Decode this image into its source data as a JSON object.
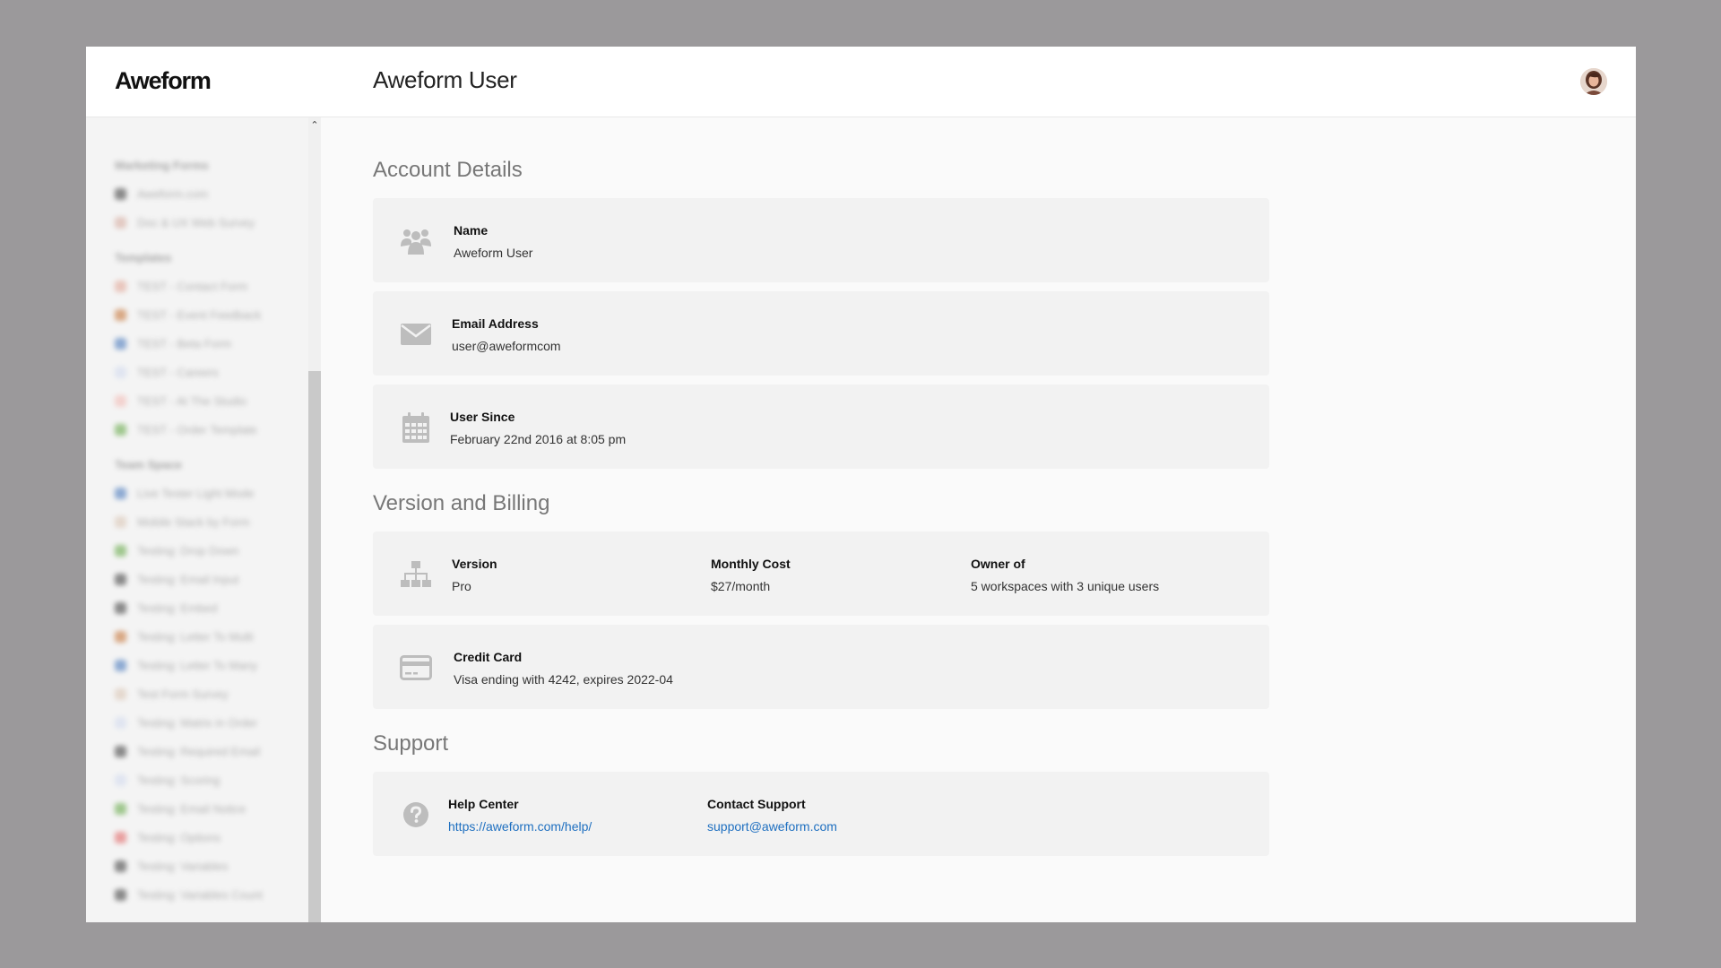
{
  "header": {
    "logo": "Aweform",
    "title": "Aweform User"
  },
  "sidebar": {
    "groups": [
      {
        "heading": "Marketing Forms",
        "items": [
          {
            "label": "Aweform.com",
            "color": "#333333"
          },
          {
            "label": "Doc & UX Web Survey",
            "color": "#d4a79a"
          }
        ]
      },
      {
        "heading": "Templates",
        "items": [
          {
            "label": "TEST - Contact Form",
            "color": "#e0a090"
          },
          {
            "label": "TEST - Event Feedback",
            "color": "#c26b2a"
          },
          {
            "label": "TEST - Beta Form",
            "color": "#3b6fb8"
          },
          {
            "label": "TEST - Careers",
            "color": "#cfd8ee"
          },
          {
            "label": "TEST - At The Studio",
            "color": "#f2b6b0"
          },
          {
            "label": "TEST - Order Template",
            "color": "#5aa33a"
          }
        ]
      },
      {
        "heading": "Team Space",
        "items": [
          {
            "label": "Live Tester Light Mode",
            "color": "#3b6fb8"
          },
          {
            "label": "Mobile Stack by Form",
            "color": "#d8c2b0"
          },
          {
            "label": "Testing: Drop Down",
            "color": "#5aa33a"
          },
          {
            "label": "Testing: Email Input",
            "color": "#333333"
          },
          {
            "label": "Testing: Embed",
            "color": "#333333"
          },
          {
            "label": "Testing: Letter To Multi",
            "color": "#c26b2a"
          },
          {
            "label": "Testing: Letter To Many",
            "color": "#3b6fb8"
          },
          {
            "label": "Test Form Survey",
            "color": "#d8c2b0"
          },
          {
            "label": "Testing: Matrix in Order",
            "color": "#cfd8ee"
          },
          {
            "label": "Testing: Required Email",
            "color": "#333333"
          },
          {
            "label": "Testing: Scoring",
            "color": "#cfd8ee"
          },
          {
            "label": "Testing: Email Notice",
            "color": "#5aa33a"
          },
          {
            "label": "Testing: Options",
            "color": "#e05a5a"
          },
          {
            "label": "Testing: Variables",
            "color": "#333333"
          },
          {
            "label": "Testing: Variables Count",
            "color": "#333333"
          }
        ]
      }
    ]
  },
  "account": {
    "heading": "Account Details",
    "name_label": "Name",
    "name_value": "Aweform User",
    "email_label": "Email Address",
    "email_value": "user@aweformcom",
    "since_label": "User Since",
    "since_value": "February 22nd 2016 at 8:05 pm"
  },
  "billing": {
    "heading": "Version and Billing",
    "version_label": "Version",
    "version_value": "Pro",
    "cost_label": "Monthly Cost",
    "cost_value": "$27/month",
    "owner_label": "Owner of",
    "owner_value": "5 workspaces with 3 unique users",
    "card_label": "Credit Card",
    "card_value": "Visa ending with 4242, expires 2022-04"
  },
  "support": {
    "heading": "Support",
    "help_label": "Help Center",
    "help_value": "https://aweform.com/help/",
    "contact_label": "Contact Support",
    "contact_value": "support@aweform.com"
  },
  "icons": {
    "name": "users-icon",
    "email": "envelope-icon",
    "since": "calendar-icon",
    "version": "sitemap-icon",
    "card": "credit-card-icon",
    "help": "question-circle-icon"
  },
  "colors": {
    "link": "#1e6fc0",
    "icon": "#bdbdbd",
    "card_bg": "#f2f2f2"
  }
}
